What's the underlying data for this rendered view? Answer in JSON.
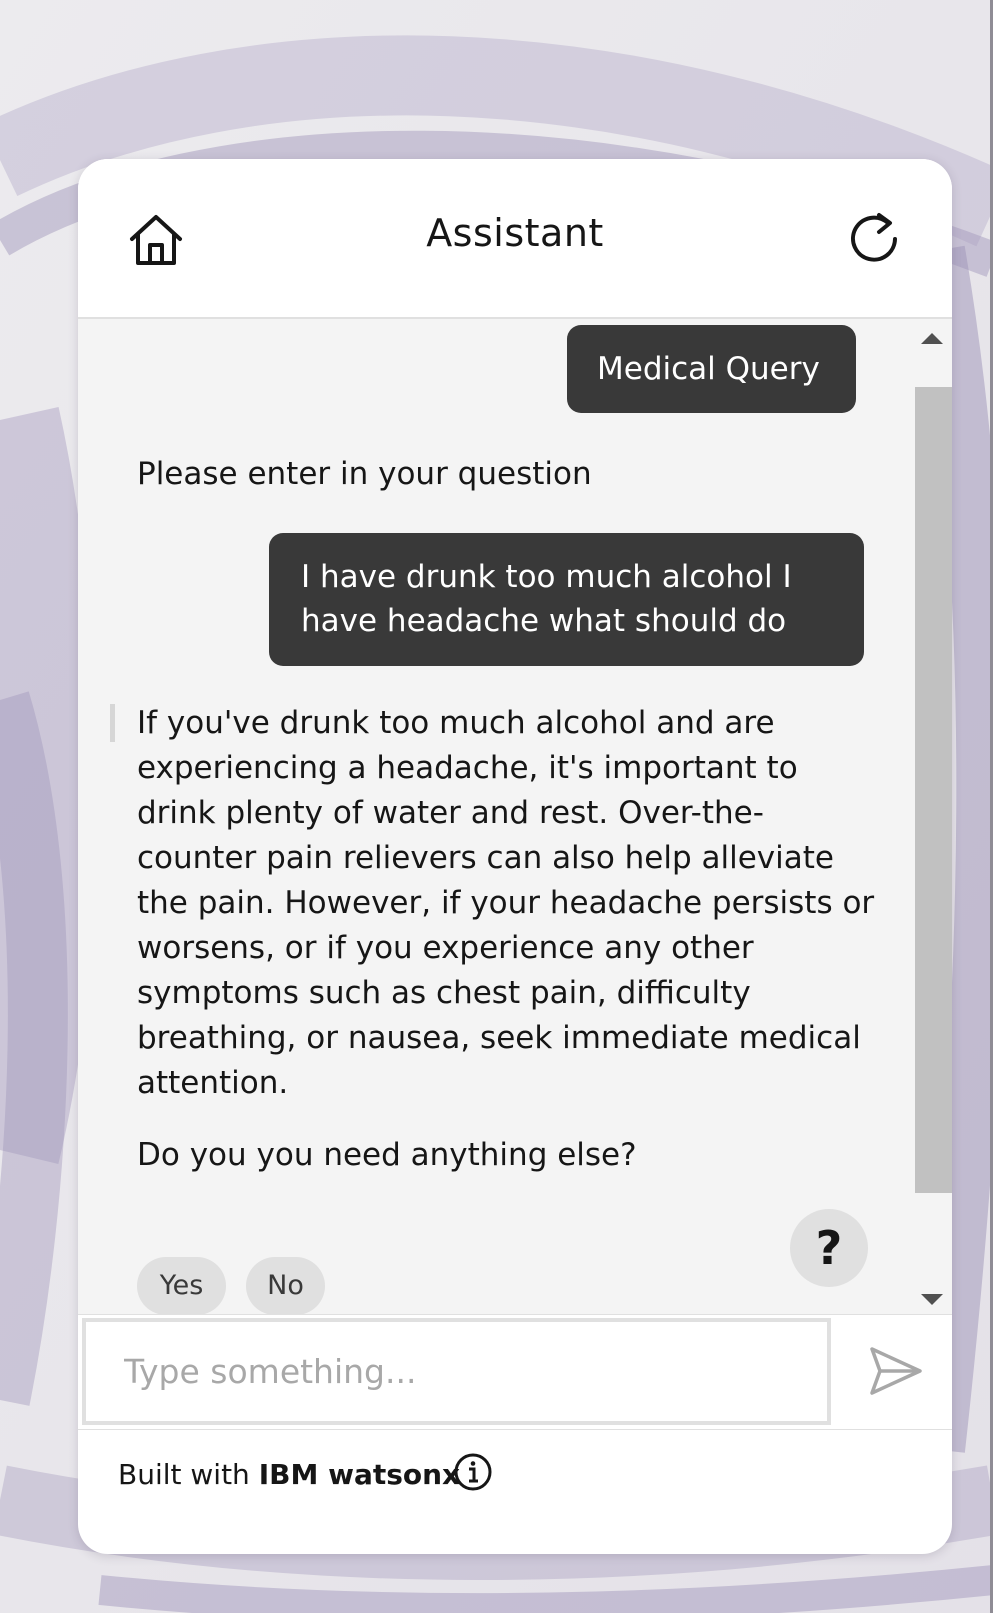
{
  "header": {
    "title": "Assistant"
  },
  "messages": {
    "user_1": "Medical Query",
    "bot_1": "Please enter in your question",
    "user_2": "I have drunk too much alcohol I have headache what should do",
    "bot_2": "If you've drunk too much alcohol and are experiencing a headache, it's important to drink plenty of water and rest. Over-the-counter pain relievers can also help alleviate the pain. However, if your headache persists or worsens, or if you experience any other symptoms such as chest pain, difficulty breathing, or nausea, seek immediate medical attention.",
    "bot_3": "Do you you need anything else?"
  },
  "quick_replies": [
    "Yes",
    "No"
  ],
  "help_label": "?",
  "input": {
    "placeholder": "Type something..."
  },
  "footer": {
    "built_with": "Built with",
    "brand": "IBM watsonx"
  },
  "icons": {
    "home": "home-icon",
    "restart": "restart-icon",
    "send": "send-icon",
    "info": "info-icon"
  },
  "colors": {
    "user_bubble": "#393939",
    "chat_background": "#f4f4f4",
    "chip_background": "#e0e0e0"
  }
}
